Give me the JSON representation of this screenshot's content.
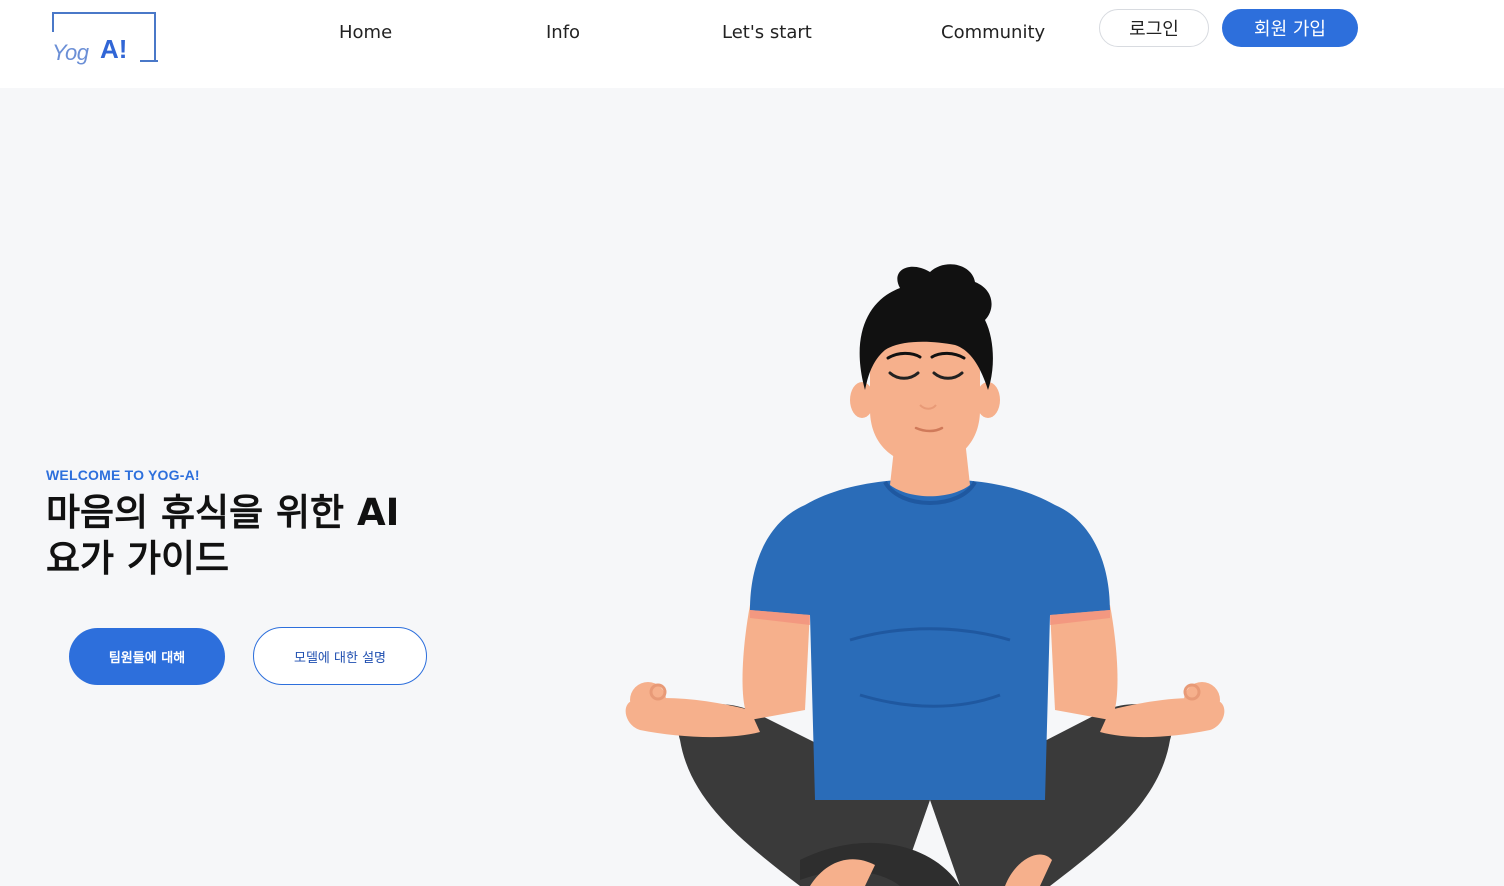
{
  "header": {
    "logo": {
      "text_yog": "Yog",
      "text_ai": "A!"
    },
    "nav": [
      {
        "label": "Home"
      },
      {
        "label": "Info"
      },
      {
        "label": "Let's start"
      },
      {
        "label": "Community"
      }
    ],
    "login_label": "로그인",
    "signup_label": "회원 가입"
  },
  "hero": {
    "eyebrow": "WELCOME TO YOG-A!",
    "title_line1": "마음의 휴식을 위한 AI",
    "title_line2": "요가 가이드",
    "primary_button": "팀원들에 대해",
    "secondary_button": "모델에 대한 설명"
  },
  "colors": {
    "accent": "#2d6fdc",
    "background": "#f6f7f9",
    "shirt": "#2a6cb8",
    "pants": "#3a3a3a",
    "skin": "#f6b08c",
    "hair": "#111111"
  },
  "illustration": {
    "icon": "meditating-person-illustration"
  }
}
